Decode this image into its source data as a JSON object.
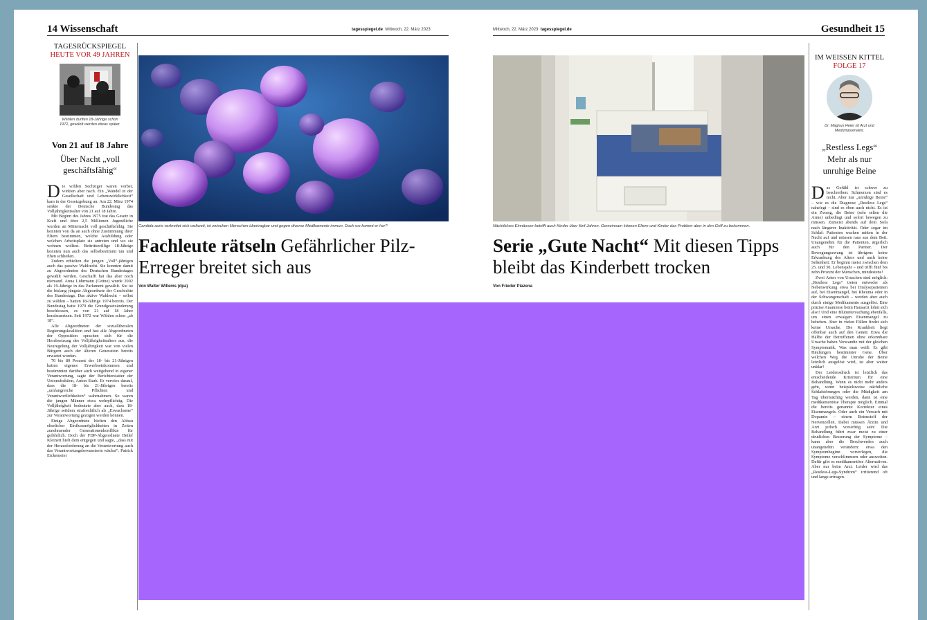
{
  "left_page": {
    "page_number": "14",
    "section": "Wissenschaft",
    "masthead_paper": "tagesspiegel.de",
    "masthead_date": "Mittwoch, 22. März 2023",
    "sidebar": {
      "kicker_1": "TAGESRÜCKSPIEGEL",
      "kicker_2": "HEUTE VOR 49 JAHREN",
      "photo_caption": "Wählen durften 18-Jährige schon 1972, gewählt werden etwas später.",
      "headline": "Von 21 auf 18 Jahre",
      "subhead": "Über Nacht „voll geschäftsfähig“",
      "dropcap": "D",
      "paragraphs": [
        "ie wilden Sechziger waren vorbei, wirkten aber nach. Ein „Wandel in der Gesellschaft und Lebenswirklichkeit“ kam in der Gesetzgebung an: Am 22. März 1974 senkte der Deutsche Bundestag das Volljährigkeitsalter von 21 auf 18 Jahre.",
        "Mit Beginn des Jahres 1975 trat das Gesetz in Kraft und über 2,5 Millionen Jugendliche wurden an Mitternacht voll geschäftsfähig. Sie konnten von da an auch ohne Zustimmung ihrer Eltern bestimmen, welche Ausbildung oder welchen Arbeitsplatz sie antreten und wo sie wohnen wollten. Beitrittswillige 18-Jährige konnten nun auch das selbstbestimmt tun und Ehen schließen.",
        "Zudem erhielten die jungen „Voll“-jährigen auch das passive Wahlrecht. Sie konnten damit zu Abgeordneten des Deutschen Bundestages gewählt werden. Geschafft hat das aber noch niemand. Anna Lührmann (Grüne) wurde 2002 als 19-Jährige in das Parlament gewählt. Sie ist die bislang jüngste Abgeordnete der Geschichte des Bundestags. Das aktive Wahlrecht – selbst zu wählen – hatten 18-Jährige 1974 bereits. Der Bundestag hatte 1970 die Grundgesetzänderung beschlossen, es von 21 auf 18 Jahre herabzusetzen. Seit 1972 war Wählen schon „ab 18“.",
        "Alle Abgeordneten der sozialliberalen Regierungskoalition und fast alle Abgeordneten der Opposition sprachen sich für die Herabsetzung des Volljährigkeitsalters aus, die Neuregelung der Volljährigkeit war von vielen Bürgern auch der älteren Generation bereits erwartet worden.",
        "70 bis 80 Prozent der 18- bis 21-Jährigen hatten eigenes Erwerbseinkommen und bestimmten darüber auch weitgehend in eigener Verantwortung, sagte der Berichterstatter der Unionsfraktion, Anton Stark. Er verwies darauf, dass die 18- bis 21-Jährigen bereits „umfangreiche Pflichten und Verantwortlichkeiten“ wahrnahmen. So waren die jungen Männer etwa wehrpflichtig. Die Volljährigkeit bedeutete aber auch, dass 18-Jährige seitdem strafrechtlich als „Erwachsene“ zur Verantwortung gezogen werden können.",
        "Einige Abgeordnete hielten den Abbau elterlicher Einflussmöglichkeiten in Zeiten zunehmender Generationenkonflikte für gefährlich. Doch der FDP-Abgeordnete Detlef Kleinert hielt dem entgegen und sagte, „dass mit der Herausforderung an die Verantwortung auch das Verantwortungsbewusstsein wächst“. Patrick Eickemeier"
      ]
    },
    "main": {
      "caption": "Candida auris verbreitet sich weltweit, ist zwischen Menschen übertragbar und gegen diverse Medikamente immun. Doch wo kommt er her?",
      "headline_bold": "Fachleute rätseln",
      "headline_rest": "Gefährlicher Pilz-Erreger breitet sich aus",
      "byline": "Von Walter Willems (dpa)"
    }
  },
  "right_page": {
    "page_number": "15",
    "section": "Gesundheit",
    "masthead_date": "Mittwoch, 22. März 2023",
    "masthead_paper": "tagesspiegel.de",
    "main": {
      "caption": "Nächtliches Einnässen betrifft auch Kinder über fünf Jahren. Gemeinsam können Eltern und Kinder das Problem aber in den Griff zu bekommen.",
      "headline_bold": "Serie „Gute Nacht“",
      "headline_rest": "Mit diesen Tipps bleibt das Kinderbett trocken",
      "byline": "Von Frieder Piazena"
    },
    "sidebar": {
      "kicker_1": "IM WEISSEN KITTEL",
      "kicker_2": "FOLGE 17",
      "portrait_caption": "Dr. Magnus Heier ist Arzt und Medizinjournalist.",
      "subhead": "„Restless Legs“ Mehr als nur unruhige Beine",
      "dropcap": "D",
      "paragraphs": [
        "as Gefühl ist schwer zu beschreiben: Schmerzen sind es nicht. Aber nur „unruhige Beine“ – wie es die Diagnose „Restless Legs“ nahelegt – sind es eben auch nicht. Es ist ein Zwang, die Beine (sehr selten die Arme) unbedingt und sofort bewegen zu müssen. Zumeist abends auf dem Sofa nach längerer Inaktivität. Oder sogar im Schlaf: Patienten wachen mitten in der Nacht auf und müssen raus aus dem Bett. Unangenehm für die Patienten, ärgerlich auch für den Partner. Der Bewegungszwang ist übrigens keine Erkrankung des Alters und auch keine Seltenheit: Er beginnt meist zwischen dem 25. und 30. Lebensjahr – und trifft fünf bis zehn Prozent der Menschen, mindestens!",
        "Zwei Arten von Ursachen sind möglich: „Restless Legs“ treten entweder als Nebenwirkung etwa bei Dialysepatienten auf, bei Eisenmangel, bei Rheuma oder in der Schwangerschaft – werden aber auch durch einige Medikamente ausgelöst. Eine präzise Anamnese beim Hausarzt lohnt sich also! Und eine Blutuntersuchung ebenfalls, um einen erwaigen Eisenmangel zu beheben. Aber in vielen Fällen findet sich keine Ursache. Die Krankheit liegt offenbar auch auf den Genen: Etwa die Hälfte der Betroffenen ohne erkennbare Ursache haben Verwandte mit der gleichen Symptomatik. Was man weiß: Es gibt Häufungen bestimmter Gene. Über welchen Weg die Unruhe der Beine letztlich ausgelöst wird, ist aber weiter unklar!",
        "Der Leidensdruck ist letztlich das entscheidende Kriterium für eine Behandlung. Wenn es nicht mehr anders geht, wenn beispielsweise nächtliche Schlafstörungen oder die Müdigkeit am Tag übermächtig werden, dann ist eine medikamentöse Therapie möglich. Einmal die bereits genannte Korrektur eines Eisenmangels. Oder auch ein Versuch mit Dopamin – einem Botenstoff der Nervenzellen. Dabei müssen Ärztin und Arzt jedoch vorsichtig sein: Die Behandlung führt zwar meist zu einer deutlichen Besserung der Symptome – kann aber die Beschwerden auch unangenehm verändern: etwa den Symptombeginn vorverlegen, die Symptome verschlimmern oder ausweiten. Dafür gibt es medikamentöse Alternativen. Aber nur beim Arzt. Leider wird das „Restless-Legs-Syndrom“ irritierend oft und lange ertragen."
      ]
    }
  },
  "colors": {
    "backdrop": "#7fa6b6",
    "placeholder_block": "#a665fd",
    "kicker_red": "#c0141c"
  }
}
